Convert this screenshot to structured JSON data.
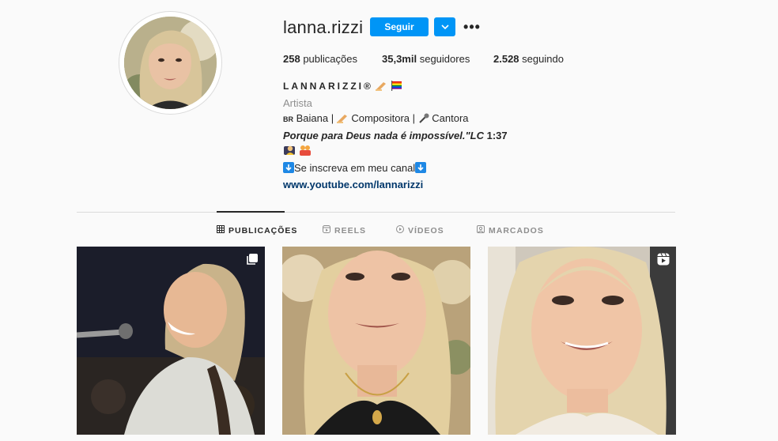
{
  "profile": {
    "username": "lanna.rizzi",
    "follow_label": "Seguir",
    "more_label": "•••",
    "stats": {
      "posts": "258",
      "posts_label": "publicações",
      "followers": "35,3mil",
      "followers_label": "seguidores",
      "following": "2.528",
      "following_label": "seguindo"
    },
    "bio": {
      "display_name": "LANNARIZZI®",
      "category": "Artista",
      "line1_prefix": "BR",
      "line1_text": "Baiana | ",
      "line1_composer": "Compositora | ",
      "line1_singer": "Cantora",
      "quote": "Porque para Deus nada é impossível.\"LC",
      "quote_ref": "1:37",
      "cta": "Se inscreva em meu canal",
      "link": "www.youtube.com/lannarizzi"
    }
  },
  "tabs": [
    {
      "label": "PUBLICAÇÕES",
      "icon": "grid-icon",
      "active": true
    },
    {
      "label": "REELS",
      "icon": "reels-icon",
      "active": false
    },
    {
      "label": "VÍDEOS",
      "icon": "video-icon",
      "active": false
    },
    {
      "label": "MARCADOS",
      "icon": "tagged-icon",
      "active": false
    }
  ],
  "posts": [
    {
      "type": "carousel",
      "badge_icon": "carousel-icon",
      "description": "singer at microphone"
    },
    {
      "type": "photo",
      "badge_icon": "",
      "description": "selfie portrait"
    },
    {
      "type": "reel",
      "badge_icon": "reels-icon",
      "description": "selfie video"
    }
  ],
  "colors": {
    "accent": "#0095f6",
    "link": "#00376b",
    "muted": "#8e8e8e",
    "text": "#262626",
    "background": "#fafafa"
  }
}
